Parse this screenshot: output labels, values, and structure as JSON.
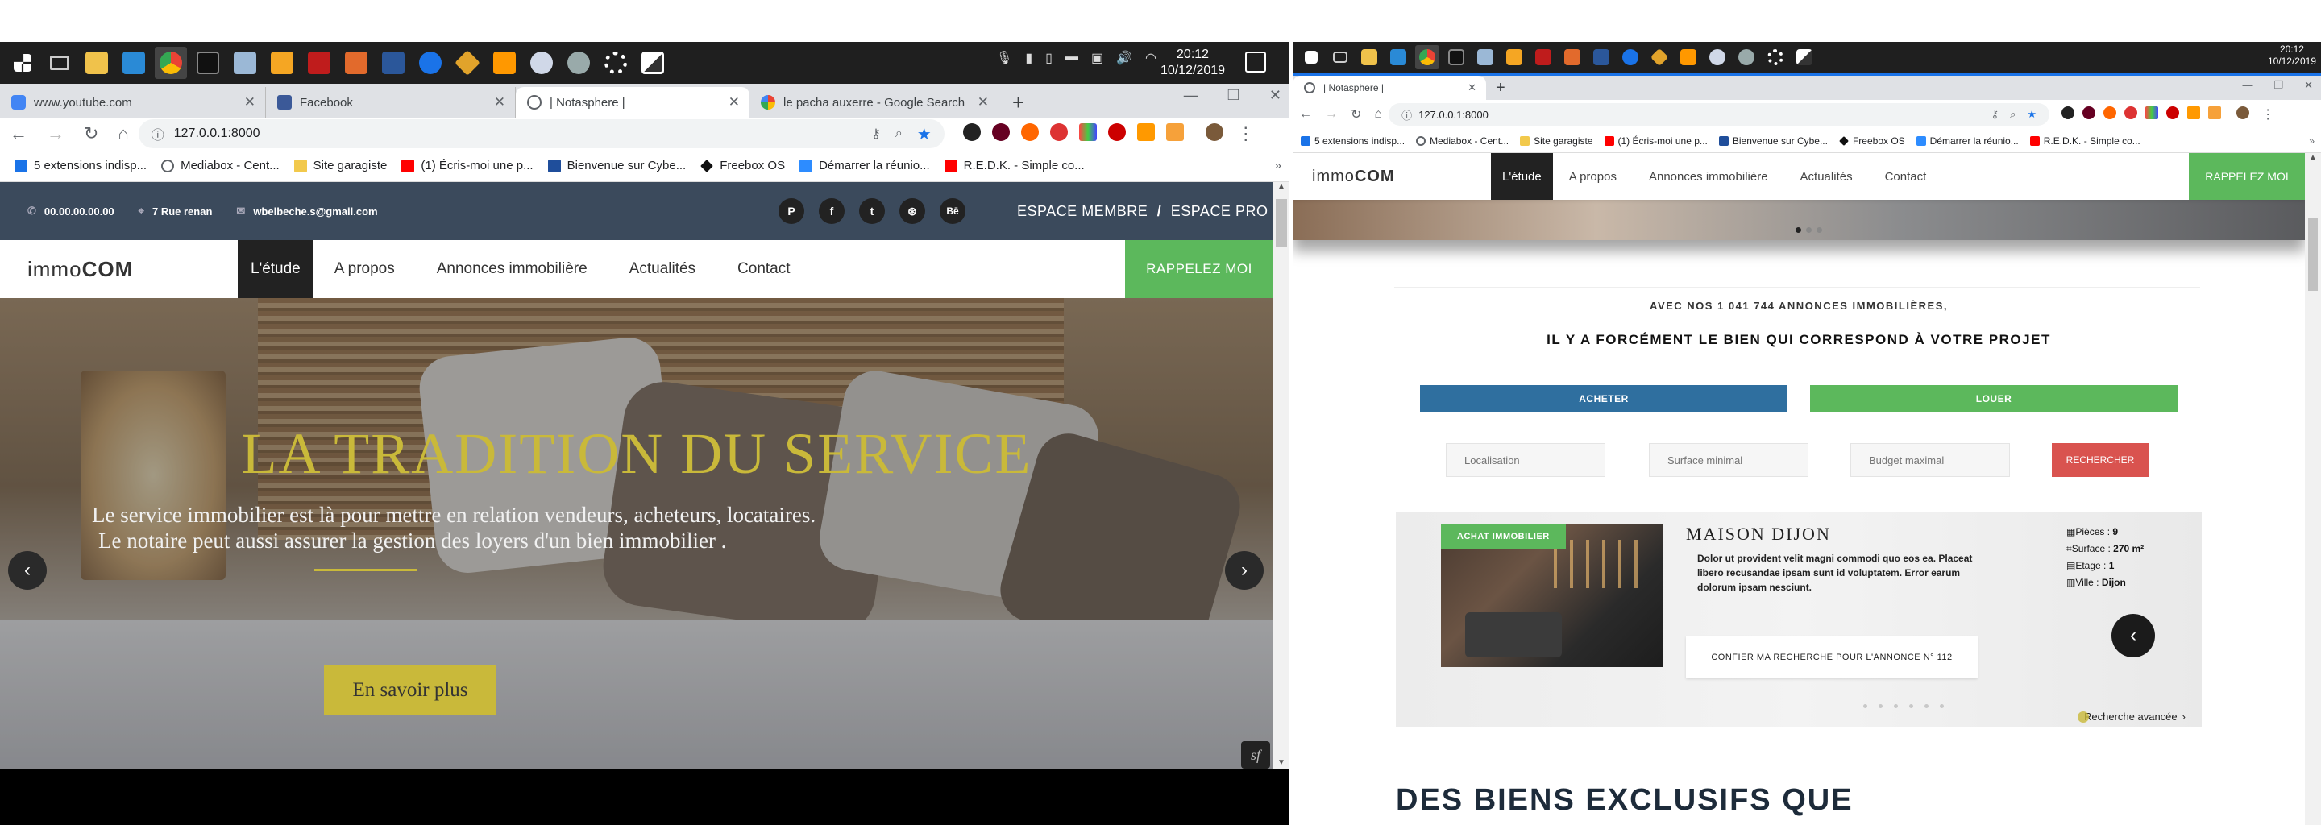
{
  "left": {
    "clock": {
      "time": "20:12",
      "date": "10/12/2019"
    },
    "tabs": [
      {
        "label": "www.youtube.com",
        "favicon_color": "#4285f4"
      },
      {
        "label": "Facebook",
        "favicon_color": "#3b5998"
      },
      {
        "label": "| Notasphere |",
        "favicon_color": "#5f6368"
      },
      {
        "label": "le pacha auxerre - Google Search",
        "favicon_color": "#ea4335"
      }
    ],
    "url": "127.0.0.1:8000",
    "bookmarks": [
      "5 extensions indisp...",
      "Mediabox - Cent...",
      "Site garagiste",
      "(1) Écris-moi une p...",
      "Bienvenue sur Cybe...",
      "Freebox OS",
      "Démarrer la réunio...",
      "R.E.D.K. - Simple co..."
    ],
    "topbar": {
      "phone": "00.00.00.00.00",
      "address": "7 Rue renan",
      "email": "wbelbeche.s@gmail.com",
      "social": [
        "P",
        "f",
        "t",
        "⊛",
        "Bē"
      ],
      "member_link": "ESPACE MEMBRE",
      "separator": "/",
      "pro_link": "ESPACE PRO"
    },
    "nav": {
      "logo_light": "immo",
      "logo_bold": "COM",
      "items": [
        "L'étude",
        "A propos",
        "Annonces immobilière",
        "Actualités",
        "Contact"
      ],
      "cta": "RAPPELEZ MOI"
    },
    "hero": {
      "title": "LA TRADITION DU SERVICE",
      "line1": "Le service immobilier est là pour mettre en relation vendeurs, acheteurs, locataires.",
      "line2": "Le notaire peut aussi assurer la gestion des loyers d'un bien immobilier .",
      "button": "En savoir plus"
    }
  },
  "right": {
    "clock": {
      "time": "20:12",
      "date": "10/12/2019"
    },
    "tab": "| Notasphere |",
    "url": "127.0.0.1:8000",
    "bookmarks": [
      "5 extensions indisp...",
      "Mediabox - Cent...",
      "Site garagiste",
      "(1) Écris-moi une p...",
      "Bienvenue sur Cybe...",
      "Freebox OS",
      "Démarrer la réunio...",
      "R.E.D.K. - Simple co..."
    ],
    "nav": {
      "logo_light": "immo",
      "logo_bold": "COM",
      "items": [
        "L'étude",
        "A propos",
        "Annonces immobilière",
        "Actualités",
        "Contact"
      ],
      "cta": "RAPPELEZ MOI"
    },
    "search": {
      "headline1": "AVEC NOS 1 041 744 ANNONCES IMMOBILIÈRES,",
      "headline2": "IL Y A FORCÉMENT LE BIEN QUI CORRESPOND À VOTRE PROJET",
      "buy": "ACHETER",
      "rent": "LOUER",
      "placeholder_location": "Localisation",
      "placeholder_surface": "Surface minimal",
      "placeholder_budget": "Budget maximal",
      "submit": "RECHERCHER"
    },
    "listing": {
      "badge": "ACHAT IMMOBILIER",
      "title": "MAISON DIJON",
      "description": "Dolor ut provident velit magni commodi quo eos ea. Placeat libero recusandae ipsam sunt id voluptatem. Error earum dolorum ipsam nesciunt.",
      "pieces_label": "Pièces :",
      "pieces": "9",
      "surface_label": "Surface :",
      "surface": "270 m²",
      "etage_label": "Etage :",
      "etage": "1",
      "ville_label": "Ville :",
      "ville": "Dijon",
      "confirm": "CONFIER MA RECHERCHE POUR L'ANNONCE N° 112",
      "advanced": "Recherche avancée"
    },
    "section_title": "DES BIENS EXCLUSIFS QUE"
  },
  "colors": {
    "accent_green": "#5cb85c",
    "blue_btn": "#2f6f9f",
    "red_btn": "#d9534f",
    "hero_gold": "#c9b93a",
    "topbar_bg": "#3b4a5c"
  }
}
